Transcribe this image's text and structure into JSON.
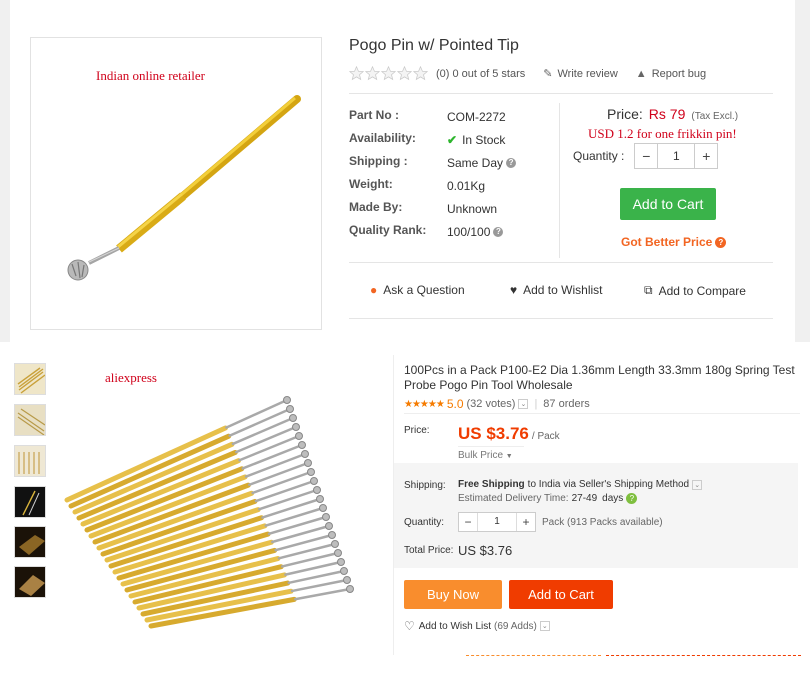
{
  "top": {
    "annotation": "Indian online retailer",
    "title": "Pogo Pin w/ Pointed Tip",
    "rating_text": "(0) 0 out of 5 stars",
    "write_review": "Write review",
    "report_bug": "Report bug",
    "specs": [
      {
        "label": "Part No :",
        "value": "COM-2272"
      },
      {
        "label": "Availability:",
        "value": "In Stock"
      },
      {
        "label": "Shipping :",
        "value": "Same Day"
      },
      {
        "label": "Weight:",
        "value": "0.01Kg"
      },
      {
        "label": "Made By:",
        "value": "Unknown"
      },
      {
        "label": "Quality Rank:",
        "value": "100/100"
      }
    ],
    "price_label": "Price:",
    "price_value": "Rs 79",
    "tax_note": "(Tax Excl.)",
    "price_annotation": "USD 1.2 for one frikkin pin!",
    "quantity_label": "Quantity :",
    "quantity_value": "1",
    "minus": "−",
    "plus": "+",
    "add_to_cart": "Add to Cart",
    "better_price": "Got Better Price",
    "ask_question": "Ask a Question",
    "add_wishlist": "Add to Wishlist",
    "add_compare": "Add to Compare",
    "accent_green": "#3ab34a",
    "accent_orange": "#f26522"
  },
  "bottom": {
    "annotation": "aliexpress",
    "title": "100Pcs in a Pack P100-E2 Dia 1.36mm Length 33.3mm 180g Spring Test Probe Pogo Pin Tool Wholesale",
    "score": "5.0",
    "votes": "(32 votes)",
    "orders": "87 orders",
    "price_label": "Price:",
    "price_value": "US $3.76",
    "price_unit": "/ Pack",
    "bulk_price": "Bulk Price",
    "shipping_label": "Shipping:",
    "free_shipping": "Free Shipping",
    "shipping_rest": "to India via Seller's Shipping Method",
    "delivery_label": "Estimated Delivery Time:",
    "delivery_value": "27-49",
    "delivery_unit": "days",
    "quantity_label": "Quantity:",
    "quantity_value": "1",
    "minus": "−",
    "plus": "+",
    "availability": "Pack (913 Packs available)",
    "total_label": "Total Price:",
    "total_value": "US $3.76",
    "buy_now": "Buy Now",
    "add_to_cart": "Add to Cart",
    "wishlist": "Add to Wish List",
    "wishlist_count": "(69 Adds)",
    "accent_orange": "#f98d2d",
    "accent_red": "#f03c00"
  }
}
